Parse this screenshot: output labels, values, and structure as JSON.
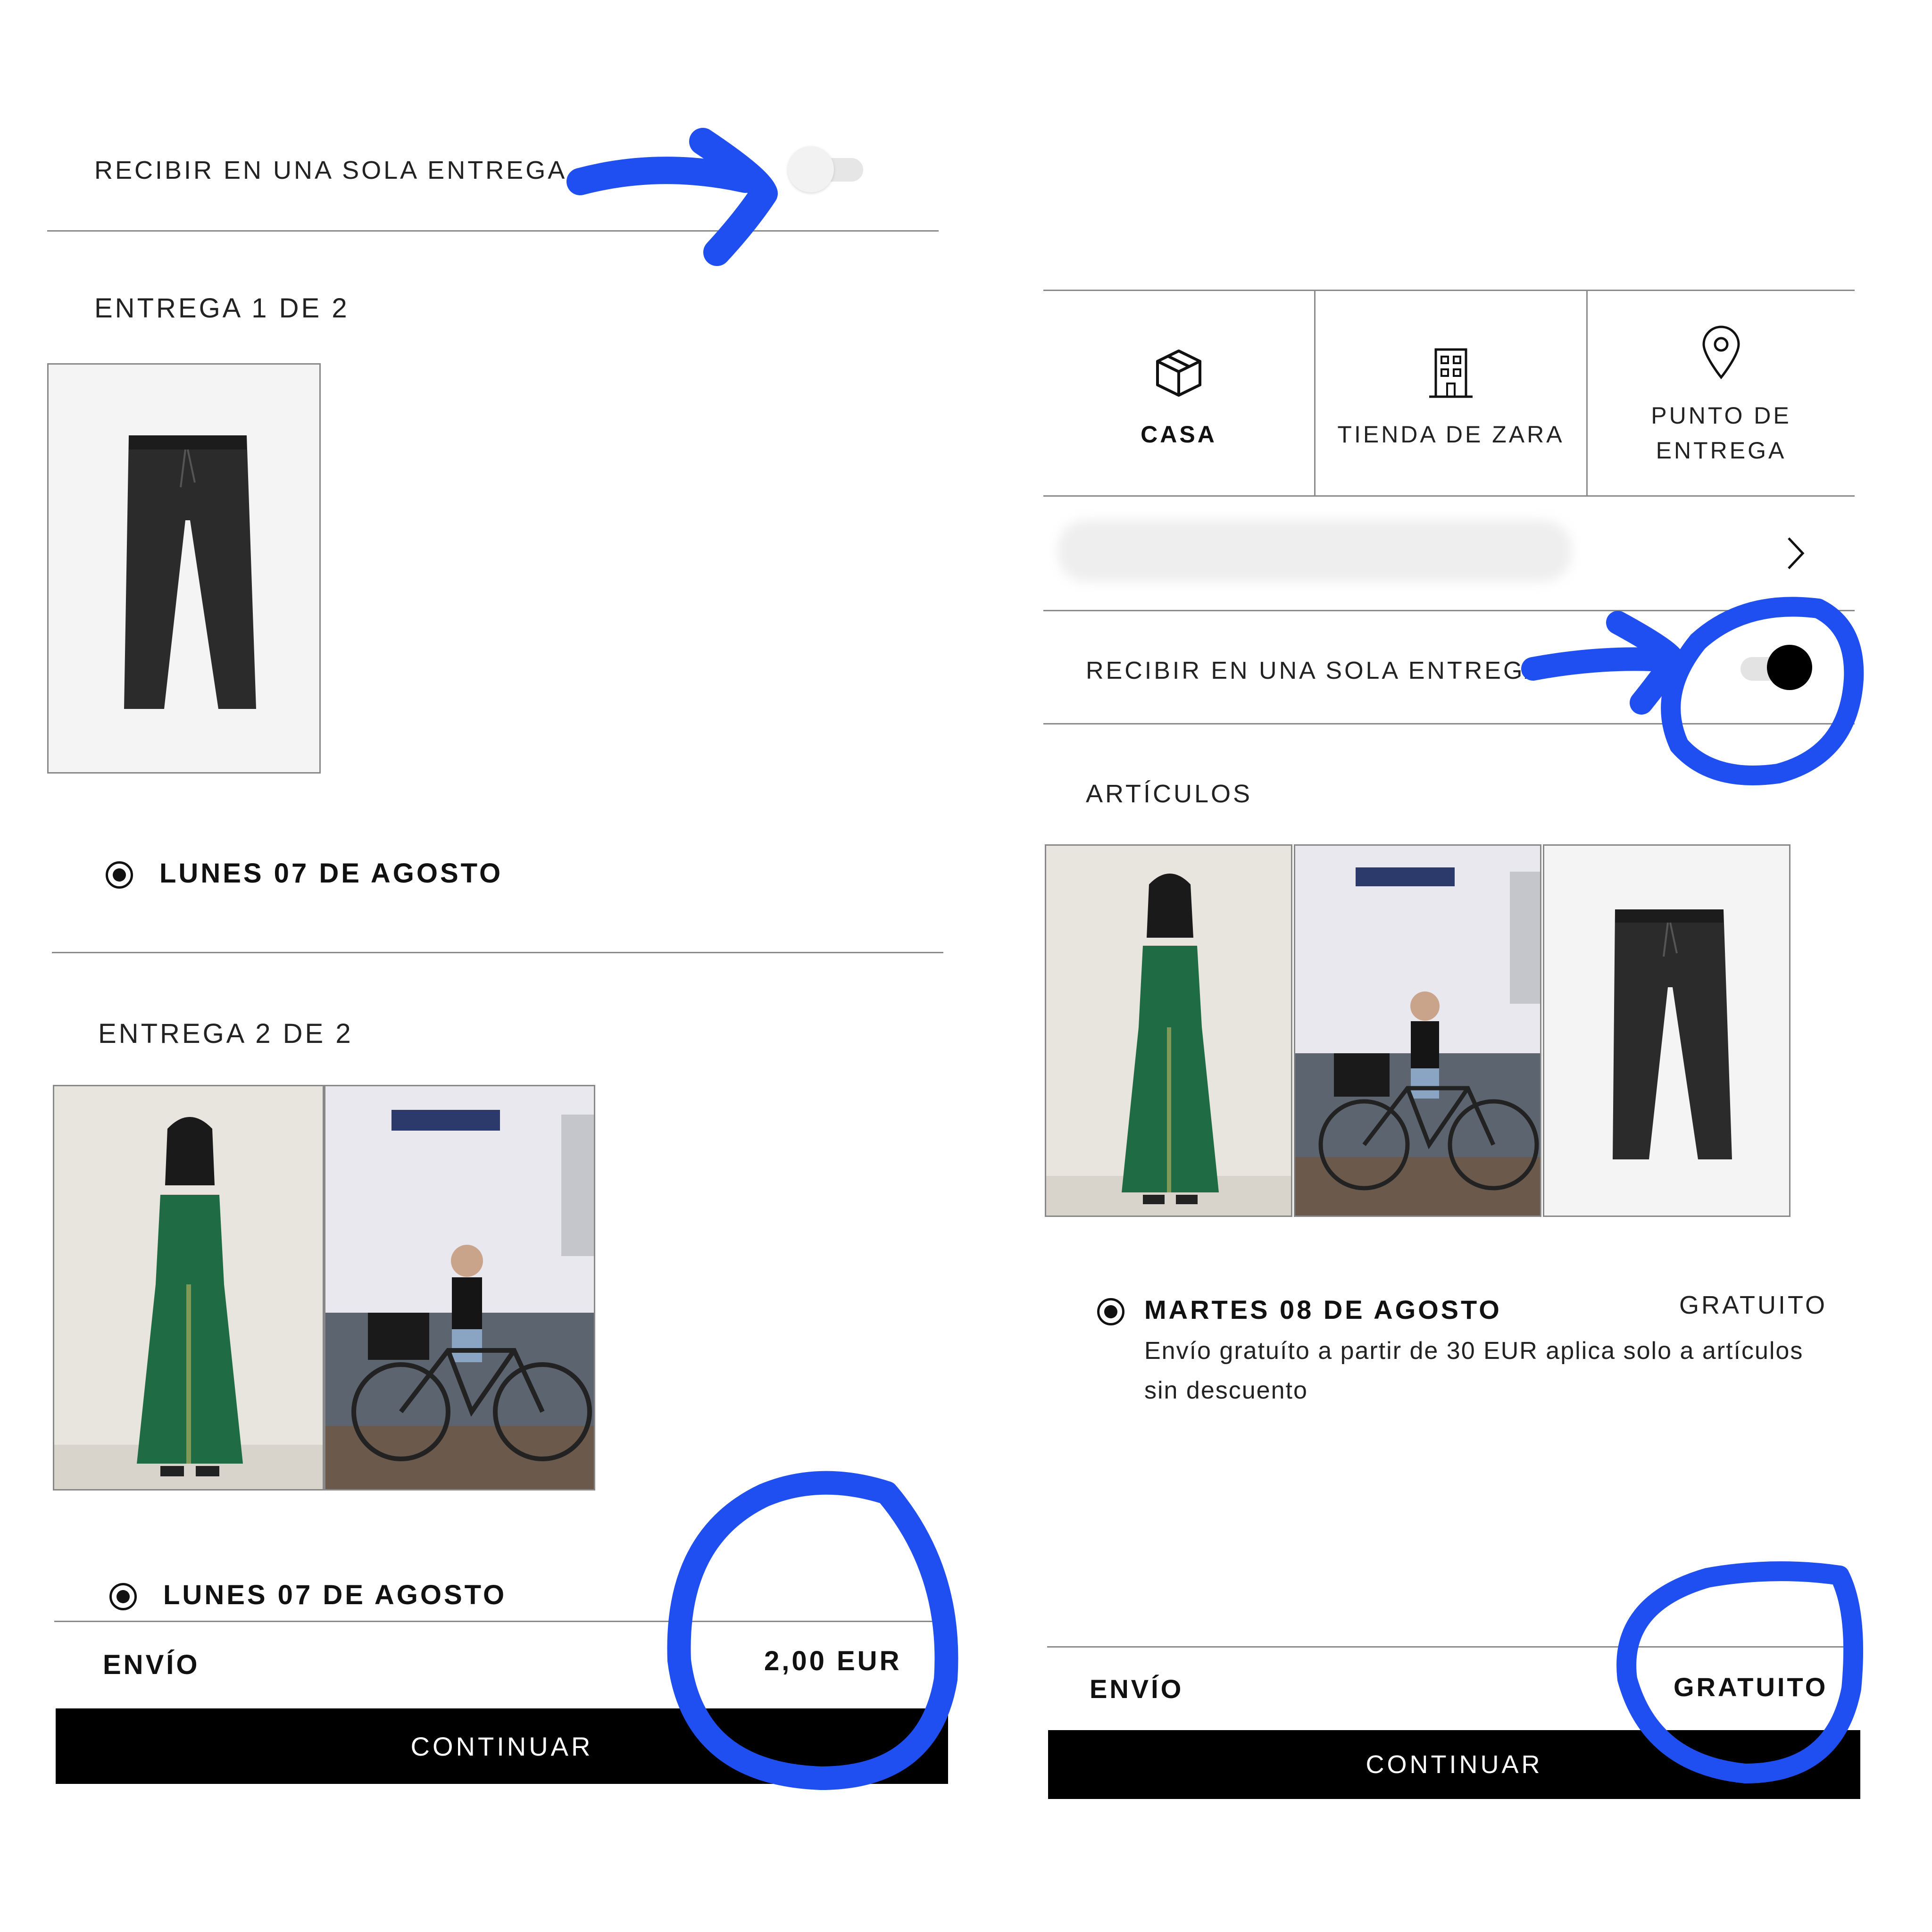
{
  "accent_color": "#1f4ff0",
  "left_panel": {
    "single_delivery_label": "RECIBIR EN UNA SOLA ENTREGA",
    "single_delivery_enabled": false,
    "delivery1": {
      "title": "ENTREGA 1 DE 2",
      "date": "LUNES 07 DE AGOSTO"
    },
    "delivery2": {
      "title": "ENTREGA 2 DE 2",
      "date": "LUNES 07 DE AGOSTO"
    },
    "shipping_label": "ENVÍO",
    "shipping_price": "2,00 EUR",
    "continue_label": "CONTINUAR"
  },
  "right_panel": {
    "tabs": [
      {
        "label": "CASA",
        "icon": "box-icon",
        "selected": true
      },
      {
        "label": "TIENDA DE ZARA",
        "icon": "building-icon",
        "selected": false
      },
      {
        "label": "PUNTO DE ENTREGA",
        "icon": "location-pin-icon",
        "selected": false
      }
    ],
    "single_delivery_label": "RECIBIR EN UNA SOLA ENTREGA",
    "single_delivery_enabled": true,
    "items_title": "ARTÍCULOS",
    "date": "MARTES 08 DE AGOSTO",
    "date_price": "GRATUITO",
    "note": "Envío gratuíto a partir de 30 EUR aplica solo a artículos sin descuento",
    "shipping_label": "ENVÍO",
    "shipping_price": "GRATUITO",
    "continue_label": "CONTINUAR"
  }
}
